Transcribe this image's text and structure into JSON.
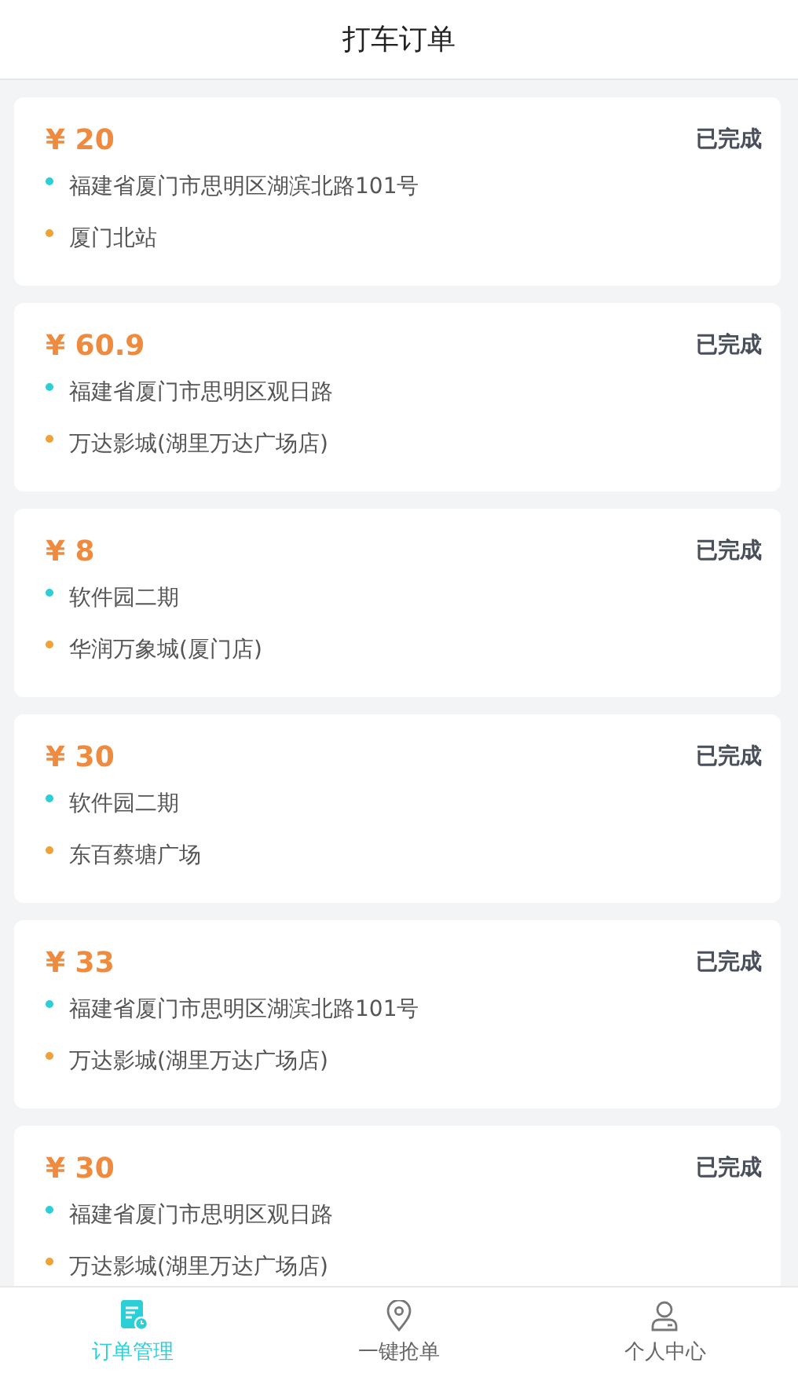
{
  "header": {
    "title": "打车订单"
  },
  "orders": [
    {
      "price": "¥ 20",
      "status": "已完成",
      "from": "福建省厦门市思明区湖滨北路101号",
      "to": "厦门北站"
    },
    {
      "price": "¥ 60.9",
      "status": "已完成",
      "from": "福建省厦门市思明区观日路",
      "to": "万达影城(湖里万达广场店)"
    },
    {
      "price": "¥ 8",
      "status": "已完成",
      "from": "软件园二期",
      "to": "华润万象城(厦门店)"
    },
    {
      "price": "¥ 30",
      "status": "已完成",
      "from": "软件园二期",
      "to": "东百蔡塘广场"
    },
    {
      "price": "¥ 33",
      "status": "已完成",
      "from": "福建省厦门市思明区湖滨北路101号",
      "to": "万达影城(湖里万达广场店)"
    },
    {
      "price": "¥ 30",
      "status": "已完成",
      "from": "福建省厦门市思明区观日路",
      "to": "万达影城(湖里万达广场店)"
    }
  ],
  "tabs": [
    {
      "kind": "orders",
      "label": "订单管理",
      "selected": true
    },
    {
      "kind": "grab",
      "label": "一键抢单",
      "selected": false
    },
    {
      "kind": "profile",
      "label": "个人中心",
      "selected": false
    }
  ]
}
